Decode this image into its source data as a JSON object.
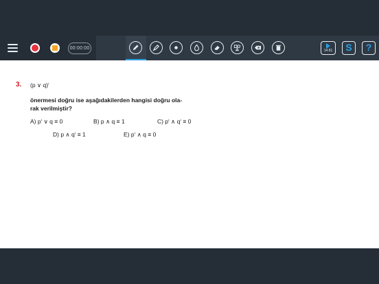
{
  "toolbar": {
    "timer": "00:00:00",
    "play_badge": "14 81"
  },
  "question": {
    "number": "3.",
    "expression": "(p ∨ q)ʹ",
    "text_line1": "önermesi doğru ise aşağıdakilerden hangisi doğru ola-",
    "text_line2": "rak verilmiştir?",
    "options": [
      "A) pʹ ∨ q ≡ 0",
      "B) p ∧ q ≡ 1",
      "C) pʹ ∧ qʹ ≡ 0",
      "D) p ∧ qʹ ≡ 1",
      "E) pʹ ∧ q ≡ 0"
    ]
  },
  "colors": {
    "accent": "#2aa0e6",
    "record": "#e8323e",
    "stop": "#f5a623",
    "question_number": "#d41e2a"
  }
}
